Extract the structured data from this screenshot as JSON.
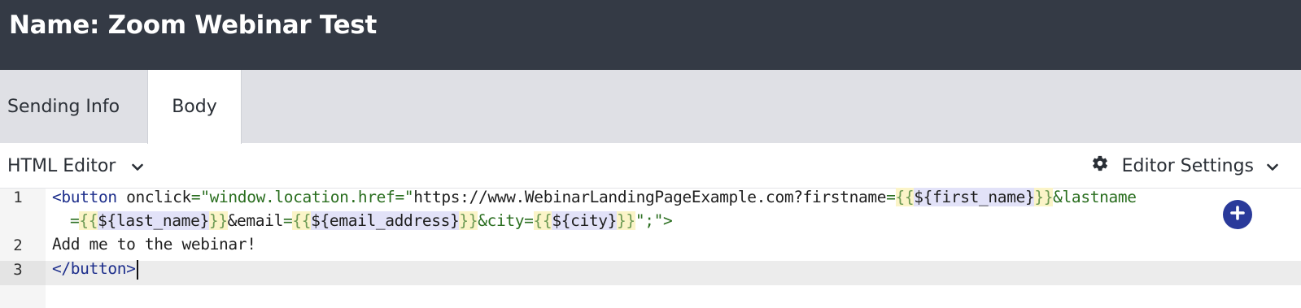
{
  "header": {
    "title": "Name: Zoom Webinar Test"
  },
  "tabs": [
    {
      "label": "Sending Info"
    },
    {
      "label": "Body"
    }
  ],
  "toolbar": {
    "mode_label": "HTML Editor",
    "settings_label": "Editor Settings"
  },
  "editor": {
    "line_numbers": [
      "1",
      "2",
      "3"
    ],
    "active_line": "3",
    "line1": {
      "open_tag": "<button",
      "attr": " onclick",
      "eq": "=",
      "str_start": "\"window.location.href=\"",
      "url": "https://www.WebinarLandingPageExample.com?firstname",
      "eq2": "=",
      "first_var": "${first_name}",
      "lastname_key": "&lastname",
      "lastname_var": "${last_name}",
      "email_key": "&email",
      "email_var": "${email_address}",
      "city_key": "&city",
      "city_var": "${city}",
      "tail": "\";\">"
    },
    "line2": "Add me to the webinar!",
    "line3": "</button>"
  },
  "icons": {
    "mode_chevron": "chevron-down-icon",
    "settings_gear": "gear-icon",
    "settings_chevron": "chevron-down-icon",
    "add": "plus-circle-icon"
  },
  "colors": {
    "header_bg": "#343a45",
    "tabbar_bg": "#dfe0e5",
    "tag": "#1e2f8c",
    "string": "#2a6e1f",
    "template_brace_bg": "#fbf4c8",
    "template_var_bg": "#e2e2f8",
    "add_button": "#2a3a9a"
  }
}
